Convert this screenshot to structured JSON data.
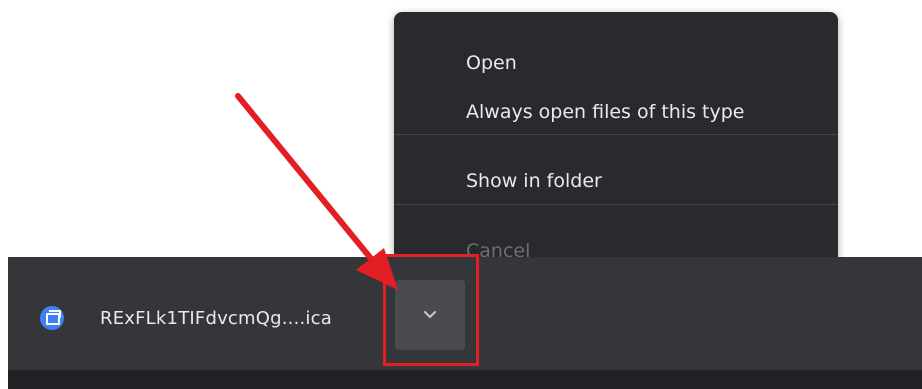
{
  "download_bar": {
    "file_name": "RExFLk1TIFdvcmQg....ica",
    "file_icon": "remote-desktop-file-icon",
    "options_icon": "chevron-down-icon"
  },
  "context_menu": {
    "items": [
      {
        "label": "Open",
        "enabled": true
      },
      {
        "label": "Always open files of this type",
        "enabled": true
      },
      {
        "label": "Show in folder",
        "enabled": true
      },
      {
        "label": "Cancel",
        "enabled": false
      }
    ]
  },
  "annotation": {
    "arrow_icon": "red-arrow-icon",
    "highlight": "red-box-highlight",
    "color": "#e31e24"
  }
}
